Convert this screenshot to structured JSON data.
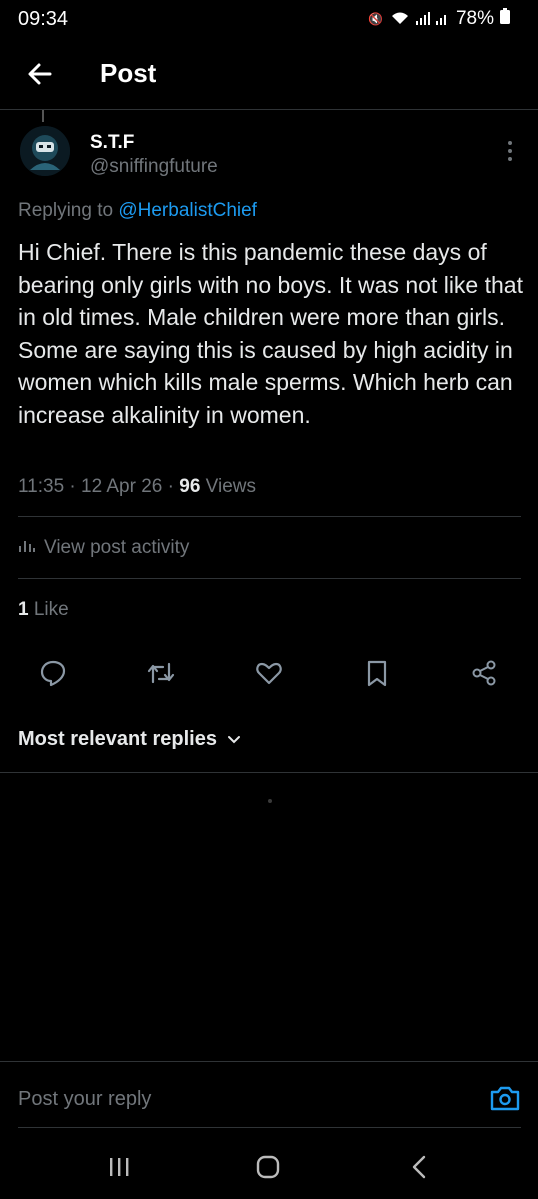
{
  "status": {
    "time": "09:34",
    "battery": "78%"
  },
  "header": {
    "title": "Post"
  },
  "post": {
    "author_name": "S.T.F",
    "author_handle": "@sniffingfuture",
    "replying_prefix": "Replying to ",
    "replying_to": "@HerbalistChief",
    "text": "Hi Chief. There is this pandemic these days of bearing only girls with no boys. It was not like that in old times. Male children were more than girls. Some are saying this is caused by high acidity in women which kills male sperms. Which herb can increase alkalinity in women.",
    "timestamp": "11:35 · 12 Apr 26 · ",
    "views_count": "96",
    "views_label": " Views",
    "activity_label": "View post activity",
    "likes_count": "1",
    "likes_label": " Like"
  },
  "actions": [
    "reply-icon",
    "repost-icon",
    "like-icon",
    "bookmark-icon",
    "share-icon"
  ],
  "replies": {
    "sort_label": "Most relevant replies"
  },
  "composer": {
    "placeholder": "Post your reply"
  },
  "colors": {
    "accent": "#1d9bf0",
    "muted": "#71767b",
    "text": "#e7e9ea",
    "divider": "#2f3336"
  }
}
